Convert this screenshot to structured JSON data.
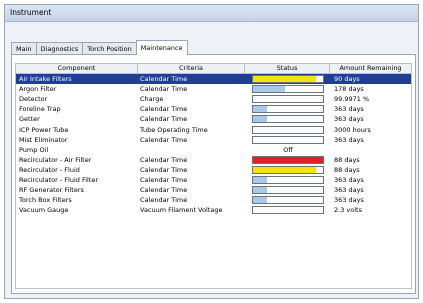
{
  "window": {
    "title": "Instrument"
  },
  "tabs": [
    {
      "label": "Main",
      "active": false
    },
    {
      "label": "Diagnostics",
      "active": false
    },
    {
      "label": "Torch Position",
      "active": false
    },
    {
      "label": "Maintenance",
      "active": true
    }
  ],
  "table": {
    "columns": [
      "Component",
      "Criteria",
      "Status",
      "Amount Remaining"
    ],
    "rows": [
      {
        "component": "Air Intake Filters",
        "criteria": "Calendar Time",
        "status_fraction": 0.9,
        "status_color": "#f2e600",
        "amount": "90 days",
        "selected": true
      },
      {
        "component": "Argon Filter",
        "criteria": "Calendar Time",
        "status_fraction": 0.45,
        "status_color": "#a8c8ec",
        "amount": "178 days"
      },
      {
        "component": "Detector",
        "criteria": "Charge",
        "status_fraction": 0.0,
        "status_color": "#a8c8ec",
        "amount": "99.9971 %"
      },
      {
        "component": "Foreline Trap",
        "criteria": "Calendar Time",
        "status_fraction": 0.2,
        "status_color": "#a8c8ec",
        "amount": "363 days"
      },
      {
        "component": "Getter",
        "criteria": "Calendar Time",
        "status_fraction": 0.2,
        "status_color": "#a8c8ec",
        "amount": "363 days"
      },
      {
        "component": "ICP Power Tube",
        "criteria": "Tube Operating Time",
        "status_fraction": 0.0,
        "status_color": "#a8c8ec",
        "amount": "3000 hours"
      },
      {
        "component": "Mist Eliminator",
        "criteria": "Calendar Time",
        "status_fraction": 0.0,
        "status_color": "#a8c8ec",
        "amount": "363 days"
      },
      {
        "component": "Pump Oil",
        "criteria": "",
        "status_text": "Off",
        "amount": ""
      },
      {
        "component": "Recirculator - Air Filter",
        "criteria": "Calendar Time",
        "status_fraction": 1.0,
        "status_color": "#e42020",
        "amount": "88 days"
      },
      {
        "component": "Recirculator - Fluid",
        "criteria": "Calendar Time",
        "status_fraction": 0.9,
        "status_color": "#f2e600",
        "amount": "88 days"
      },
      {
        "component": "Recirculator - Fluid Filter",
        "criteria": "Calendar Time",
        "status_fraction": 0.2,
        "status_color": "#a8c8ec",
        "amount": "363 days"
      },
      {
        "component": "RF Generator Filters",
        "criteria": "Calendar Time",
        "status_fraction": 0.2,
        "status_color": "#a8c8ec",
        "amount": "363 days"
      },
      {
        "component": "Torch Box Filters",
        "criteria": "Calendar Time",
        "status_fraction": 0.2,
        "status_color": "#a8c8ec",
        "amount": "363 days"
      },
      {
        "component": "Vacuum Gauge",
        "criteria": "Vacuum Filament Voltage",
        "status_fraction": 0.0,
        "status_color": "#a8c8ec",
        "amount": "2.3 volts"
      }
    ]
  }
}
